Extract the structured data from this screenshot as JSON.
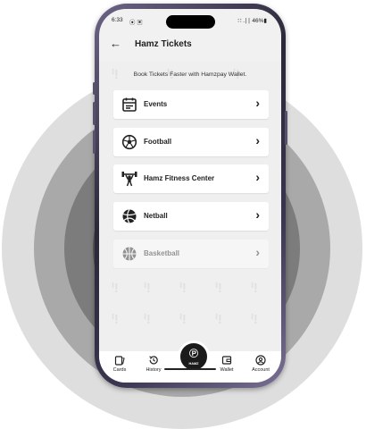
{
  "status_bar": {
    "time": "6:33",
    "indicators": "⦿ ▣",
    "right": "∷ .∣∣ 46%▮"
  },
  "header": {
    "back_icon": "arrow-left-icon",
    "title": "Hamz Tickets"
  },
  "subtitle": "Book Tickets Faster with Hamzpay Wallet.",
  "categories": [
    {
      "label": "Events",
      "icon": "calendar-icon",
      "enabled": true
    },
    {
      "label": "Football",
      "icon": "football-icon",
      "enabled": true
    },
    {
      "label": "Hamz Fitness Center",
      "icon": "weightlifter-icon",
      "enabled": true
    },
    {
      "label": "Netball",
      "icon": "netball-icon",
      "enabled": true
    },
    {
      "label": "Basketball",
      "icon": "basketball-icon",
      "enabled": false
    }
  ],
  "bottom_nav": {
    "cards": "Cards",
    "history": "History",
    "center_logo": "HAMZ",
    "wallet": "Wallet",
    "account": "Account"
  },
  "colors": {
    "accent": "#1b1b1b",
    "background": "#efefef",
    "card": "#ffffff"
  }
}
